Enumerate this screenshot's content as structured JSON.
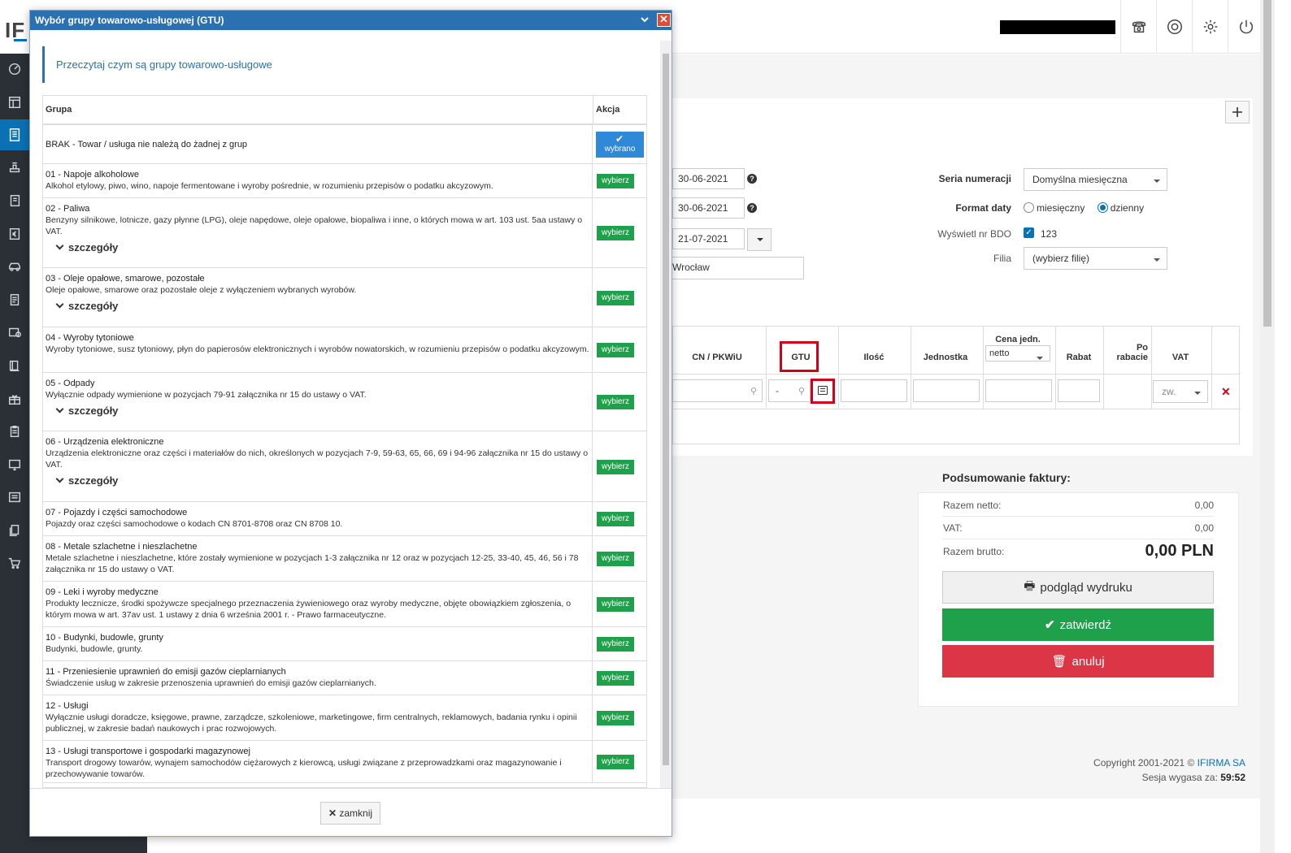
{
  "app": {
    "logo_text": "IF"
  },
  "sidebar": {
    "items": [
      "dashboard-icon",
      "layout-icon",
      "invoice-icon",
      "stamp-icon",
      "documents-icon",
      "euro-icon",
      "car-icon",
      "receipt-icon",
      "card-icon",
      "book-icon",
      "gift-icon",
      "clipboard-icon",
      "monitor-icon",
      "list-icon",
      "copy-icon",
      "cart-icon"
    ],
    "active_index": 2
  },
  "topbar": {
    "icons": [
      "phone-icon",
      "lifebuoy-icon",
      "gear-icon",
      "power-icon"
    ]
  },
  "form": {
    "date1": "30-06-2021",
    "date2": "30-06-2021",
    "date3": "21-07-2021",
    "place": "Wrocław",
    "seria_label": "Seria numeracji",
    "seria_value": "Domyślna miesięczna",
    "format_label": "Format daty",
    "format_opt1": "miesięczny",
    "format_opt2": "dzienny",
    "bdo_label": "Wyświetl nr BDO",
    "bdo_value": "123",
    "filia_label": "Filia",
    "filia_value": "(wybierz filię)"
  },
  "items_table": {
    "col_cn": "CN / PKWiU",
    "col_gtu": "GTU",
    "col_ilosc": "Ilość",
    "col_jednostka": "Jednostka",
    "col_cena": "Cena jedn.",
    "col_cena_sel": "netto",
    "col_rabat": "Rabat",
    "col_po1": "Po",
    "col_po2": "rabacie",
    "col_vat": "VAT",
    "gtu_value": "-",
    "vat_value": "zw."
  },
  "summary": {
    "title": "Podsumowanie faktury:",
    "netto_label": "Razem netto:",
    "netto_value": "0,00",
    "vat_label": "VAT:",
    "vat_value": "0,00",
    "brutto_label": "Razem brutto:",
    "brutto_value": "0,00 PLN",
    "btn_preview": "podgląd wydruku",
    "btn_confirm": "zatwierdź",
    "btn_cancel": "anuluj"
  },
  "footer": {
    "copyright": "Copyright 2001-2021 ©",
    "company": "IFIRMA SA",
    "session_label": "Sesja wygasa za:",
    "session_value": "59:52"
  },
  "dialog": {
    "title": "Wybór grupy towarowo-usługowej (GTU)",
    "note": "Przeczytaj czym są grupy towarowo-usługowe",
    "col_group": "Grupa",
    "col_action": "Akcja",
    "selected_label": "wybrano",
    "choose_label": "wybierz",
    "details_label": "szczegóły",
    "close_label": "zamknij",
    "groups": [
      {
        "title": "BRAK - Towar / usługa nie należą do żadnej z grup",
        "desc": ""
      },
      {
        "title": "01 - Napoje alkoholowe",
        "desc": "Alkohol etylowy, piwo, wino, napoje fermentowane i wyroby pośrednie, w rozumieniu przepisów o podatku akcyzowym."
      },
      {
        "title": "02 - Paliwa",
        "desc": "Benzyny silnikowe, lotnicze, gazy płynne (LPG), oleje napędowe, oleje opałowe, biopaliwa i inne, o których mowa w art. 103 ust. 5aa ustawy o VAT."
      },
      {
        "title": "03 - Oleje opałowe, smarowe, pozostałe",
        "desc": "Oleje opałowe, smarowe oraz pozostałe oleje z wyłączeniem wybranych wyrobów."
      },
      {
        "title": "04 - Wyroby tytoniowe",
        "desc": "Wyroby tytoniowe, susz tytoniowy, płyn do papierosów elektronicznych i wyrobów nowatorskich, w rozumieniu przepisów o podatku akcyzowym."
      },
      {
        "title": "05 - Odpady",
        "desc": "Wyłącznie odpady wymienione w pozycjach 79-91 załącznika nr 15 do ustawy o VAT."
      },
      {
        "title": "06 - Urządzenia elektroniczne",
        "desc": "Urządzenia elektroniczne oraz części i materiałów do nich, określonych w pozycjach 7-9, 59-63, 65, 66, 69 i 94-96 załącznika nr 15 do ustawy o VAT."
      },
      {
        "title": "07 - Pojazdy i części samochodowe",
        "desc": "Pojazdy oraz części samochodowe o kodach CN 8701-8708 oraz CN 8708 10."
      },
      {
        "title": "08 - Metale szlachetne i nieszlachetne",
        "desc": "Metale szlachetne i nieszlachetne, które zostały wymienione w pozycjach 1-3 załącznika nr 12 oraz w pozycjach 12-25, 33-40, 45, 46, 56 i 78 załącznika nr 15 do ustawy o VAT."
      },
      {
        "title": "09 - Leki i wyroby medyczne",
        "desc": "Produkty lecznicze, środki spożywcze specjalnego przeznaczenia żywieniowego oraz wyroby medyczne, objęte obowiązkiem zgłoszenia, o którym mowa w art. 37av ust. 1 ustawy z dnia 6 września 2001 r. - Prawo farmaceutyczne."
      },
      {
        "title": "10 - Budynki, budowle, grunty",
        "desc": "Budynki, budowle, grunty."
      },
      {
        "title": "11 - Przeniesienie uprawnień do emisji gazów cieplarnianych",
        "desc": "Świadczenie usług w zakresie przenoszenia uprawnień do emisji gazów cieplarnianych."
      },
      {
        "title": "12 - Usługi",
        "desc": "Wyłącznie usługi doradcze, księgowe, prawne, zarządcze, szkoleniowe, marketingowe, firm centralnych, reklamowych, badania rynku i opinii publicznej, w zakresie badań naukowych i prac rozwojowych."
      },
      {
        "title": "13 - Usługi transportowe i gospodarki magazynowej",
        "desc": "Transport drogowy towarów, wynajem samochodów ciężarowych z kierowcą, usługi związane z przeprowadzkami oraz magazynowanie i przechowywanie towarów."
      }
    ]
  }
}
